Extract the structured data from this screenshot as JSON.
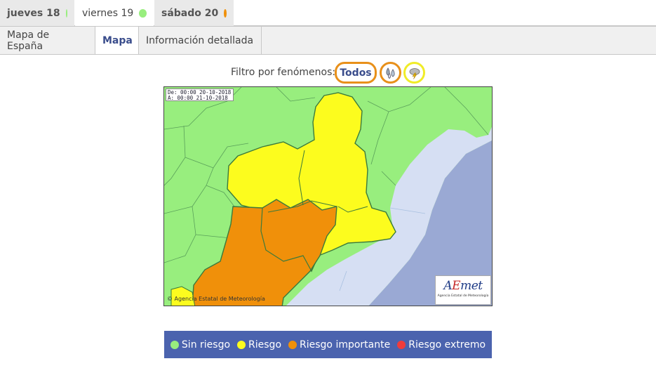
{
  "day_tabs": [
    {
      "label": "jueves 18",
      "status_color": "#98ee7e",
      "selected": false
    },
    {
      "label": "viernes 19",
      "status_color": "#98ee7e",
      "selected": true
    },
    {
      "label": "sábado 20",
      "status_color": "#f0900a",
      "selected": false
    }
  ],
  "view_tabs": [
    {
      "label": "Mapa de España",
      "active": false
    },
    {
      "label": "Mapa",
      "active": true
    },
    {
      "label": "Información detallada",
      "active": false
    }
  ],
  "filter": {
    "label": "Filtro por fenómenos:",
    "all_button": "Todos",
    "phenomena": [
      {
        "icon": "rain-icon",
        "ring_color": "#e8901a"
      },
      {
        "icon": "storm-icon",
        "ring_color": "#f0ec28"
      }
    ]
  },
  "map": {
    "date_from": "De: 00:00 20-10-2018",
    "date_to": "A:  00:00 21-10-2018",
    "credit": "Agencia Estatal de Meteorología",
    "logo_wordmark_a": "A",
    "logo_wordmark_e": "E",
    "logo_wordmark_rest": "met",
    "logo_subtitle": "Agencia Estatal de Meteorología",
    "colors": {
      "no_risk": "#98ee7e",
      "risk": "#fcfc1e",
      "important": "#f0900a",
      "sea": "#d6dff3",
      "deep_sea": "#9aa9d4"
    }
  },
  "legend": [
    {
      "label": "Sin riesgo",
      "color": "#98ee7e"
    },
    {
      "label": "Riesgo",
      "color": "#fcfc1e"
    },
    {
      "label": "Riesgo importante",
      "color": "#f0900a"
    },
    {
      "label": "Riesgo extremo",
      "color": "#f03c3c"
    }
  ]
}
